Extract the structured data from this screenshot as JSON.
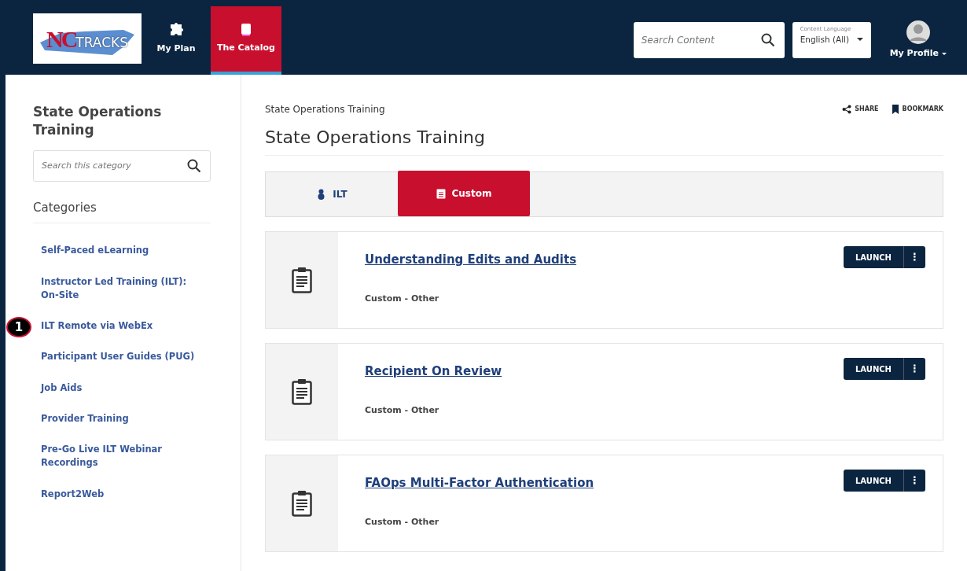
{
  "header": {
    "logo": {
      "mark": "NC",
      "word": "TRACKS"
    },
    "nav": [
      {
        "label": "My Plan",
        "kind": "plan",
        "selected": false
      },
      {
        "label": "The Catalog",
        "kind": "catalog",
        "selected": true
      }
    ],
    "search": {
      "placeholder": "Search Content"
    },
    "language": {
      "label": "Content Language",
      "value": "English (All)"
    },
    "profile": {
      "label": "My Profile"
    }
  },
  "sidebar": {
    "title": "State Operations Training",
    "search": {
      "placeholder": "Search this category"
    },
    "heading": "Categories",
    "items": [
      {
        "label": "Self-Paced eLearning"
      },
      {
        "label": "Instructor Led Training (ILT): On-Site"
      },
      {
        "label": "ILT Remote via WebEx",
        "callout": "1"
      },
      {
        "label": "Participant User Guides (PUG)"
      },
      {
        "label": "Job Aids"
      },
      {
        "label": "Provider Training"
      },
      {
        "label": "Pre-Go Live ILT Webinar Recordings"
      },
      {
        "label": "Report2Web"
      }
    ]
  },
  "main": {
    "breadcrumb": "State Operations Training",
    "share": "SHARE",
    "bookmark": "BOOKMARK",
    "title": "State Operations Training",
    "tabs": [
      {
        "label": "ILT",
        "kind": "ilt",
        "selected": false
      },
      {
        "label": "Custom",
        "kind": "custom",
        "selected": true
      }
    ],
    "items": [
      {
        "title": "Understanding Edits and Audits",
        "type": "Custom - Other",
        "action": "LAUNCH",
        "more": "⋮"
      },
      {
        "title": "Recipient On Review",
        "type": "Custom - Other",
        "action": "LAUNCH",
        "more": "⋮"
      },
      {
        "title": "FAOps Multi-Factor Authentication",
        "type": "Custom - Other",
        "action": "LAUNCH",
        "more": "⋮"
      }
    ]
  }
}
